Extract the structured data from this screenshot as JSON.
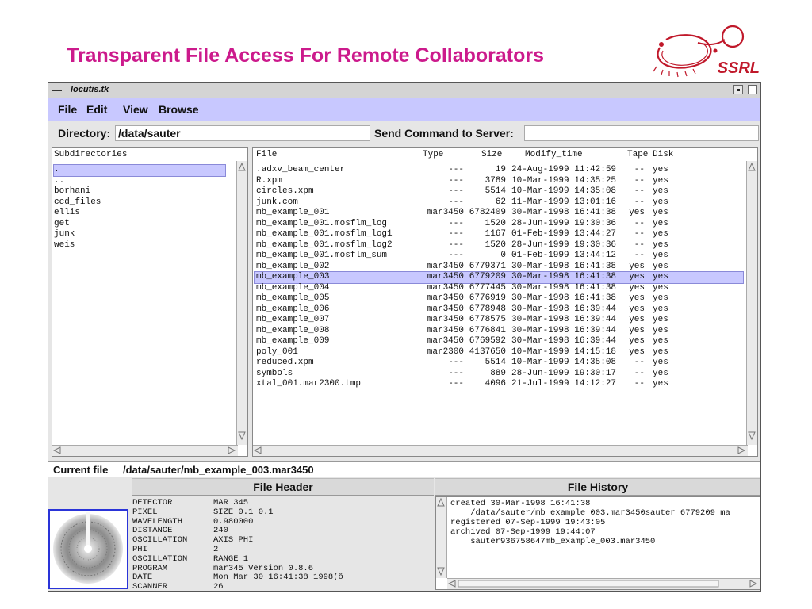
{
  "slide": {
    "title": "Transparent File Access For Remote Collaborators",
    "logo_text": "SSRL"
  },
  "window": {
    "title": "locutis.tk",
    "menu": [
      "File",
      "Edit",
      "View",
      "Browse"
    ],
    "directory_label": "Directory:",
    "directory_value": "/data/sauter",
    "command_label": "Send Command to Server:",
    "command_value": ""
  },
  "subdirectories": {
    "header": "Subdirectories",
    "items": [
      ".",
      "..",
      "borhani",
      "ccd_files",
      "ellis",
      "get",
      "junk",
      "weis"
    ],
    "selected_index": 0
  },
  "files": {
    "columns": [
      "File",
      "Type",
      "Size",
      "Modify_time",
      "Tape",
      "Disk"
    ],
    "rows": [
      [
        ".adxv_beam_center",
        "---",
        "19",
        "24-Aug-1999 11:42:59",
        "--",
        "yes"
      ],
      [
        "R.xpm",
        "---",
        "3789",
        "10-Mar-1999 14:35:25",
        "--",
        "yes"
      ],
      [
        "circles.xpm",
        "---",
        "5514",
        "10-Mar-1999 14:35:08",
        "--",
        "yes"
      ],
      [
        "junk.com",
        "---",
        "62",
        "11-Mar-1999 13:01:16",
        "--",
        "yes"
      ],
      [
        "mb_example_001",
        "mar3450",
        "6782409",
        "30-Mar-1998 16:41:38",
        "yes",
        "yes"
      ],
      [
        "mb_example_001.mosflm_log",
        "---",
        "1520",
        "28-Jun-1999 19:30:36",
        "--",
        "yes"
      ],
      [
        "mb_example_001.mosflm_log1",
        "---",
        "1167",
        "01-Feb-1999 13:44:27",
        "--",
        "yes"
      ],
      [
        "mb_example_001.mosflm_log2",
        "---",
        "1520",
        "28-Jun-1999 19:30:36",
        "--",
        "yes"
      ],
      [
        "mb_example_001.mosflm_sum",
        "---",
        "0",
        "01-Feb-1999 13:44:12",
        "--",
        "yes"
      ],
      [
        "mb_example_002",
        "mar3450",
        "6779371",
        "30-Mar-1998 16:41:38",
        "yes",
        "yes"
      ],
      [
        "mb_example_003",
        "mar3450",
        "6779209",
        "30-Mar-1998 16:41:38",
        "yes",
        "yes"
      ],
      [
        "mb_example_004",
        "mar3450",
        "6777445",
        "30-Mar-1998 16:41:38",
        "yes",
        "yes"
      ],
      [
        "mb_example_005",
        "mar3450",
        "6776919",
        "30-Mar-1998 16:41:38",
        "yes",
        "yes"
      ],
      [
        "mb_example_006",
        "mar3450",
        "6778948",
        "30-Mar-1998 16:39:44",
        "yes",
        "yes"
      ],
      [
        "mb_example_007",
        "mar3450",
        "6778575",
        "30-Mar-1998 16:39:44",
        "yes",
        "yes"
      ],
      [
        "mb_example_008",
        "mar3450",
        "6776841",
        "30-Mar-1998 16:39:44",
        "yes",
        "yes"
      ],
      [
        "mb_example_009",
        "mar3450",
        "6769592",
        "30-Mar-1998 16:39:44",
        "yes",
        "yes"
      ],
      [
        "poly_001",
        "mar2300",
        "4137650",
        "10-Mar-1999 14:15:18",
        "yes",
        "yes"
      ],
      [
        "reduced.xpm",
        "---",
        "5514",
        "10-Mar-1999 14:35:08",
        "--",
        "yes"
      ],
      [
        "symbols",
        "---",
        "889",
        "28-Jun-1999 19:30:17",
        "--",
        "yes"
      ],
      [
        "xtal_001.mar2300.tmp",
        "---",
        "4096",
        "21-Jul-1999 14:12:27",
        "--",
        "yes"
      ]
    ],
    "selected_index": 10
  },
  "current_file": {
    "label": "Current file",
    "value": "/data/sauter/mb_example_003.mar3450"
  },
  "file_header": {
    "title": "File Header",
    "entries": [
      [
        "DETECTOR",
        "MAR 345"
      ],
      [
        "PIXEL",
        "SIZE 0.1 0.1"
      ],
      [
        "WAVELENGTH",
        "0.980000"
      ],
      [
        "DISTANCE",
        "240"
      ],
      [
        "OSCILLATION",
        "AXIS PHI"
      ],
      [
        "PHI",
        "2"
      ],
      [
        "OSCILLATION",
        "RANGE 1"
      ],
      [
        "PROGRAM",
        "mar345 Version 0.8.6"
      ],
      [
        "DATE",
        "Mon Mar 30 16:41:38 1998(ô"
      ],
      [
        "SCANNER",
        "26"
      ]
    ]
  },
  "file_history": {
    "title": "File History",
    "lines": [
      "created 30-Mar-1998 16:41:38",
      "    /data/sauter/mb_example_003.mar3450sauter 6779209 ma",
      "registered 07-Sep-1999 19:43:05",
      "archived 07-Sep-1999 19:44:07",
      "    sauter936758647mb_example_003.mar3450"
    ]
  },
  "colors": {
    "title_magenta": "#cc1a8c",
    "menu_lavender": "#c8c8ff",
    "selection": "#c8c8ff",
    "logo_red": "#c0182a",
    "thumbnail_border": "#2a34d8"
  }
}
